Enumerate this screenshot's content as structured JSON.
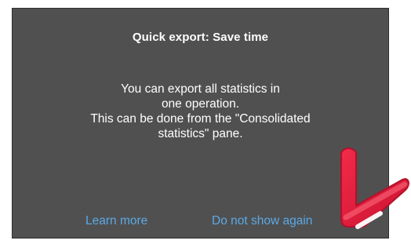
{
  "dialog": {
    "title": "Quick export: Save time",
    "body_lines": [
      "You can export all statistics in",
      "one operation.",
      "This can be done from the \"Consolidated",
      "statistics\" pane."
    ],
    "actions": {
      "learn_more": "Learn more",
      "do_not_show_again": "Do not show again"
    }
  },
  "annotation": {
    "icon": "arrow-down-left-icon",
    "color": "#e31b3b"
  },
  "colors": {
    "dialog_background": "#505050",
    "link": "#5ba9e6",
    "text": "#ffffff"
  }
}
